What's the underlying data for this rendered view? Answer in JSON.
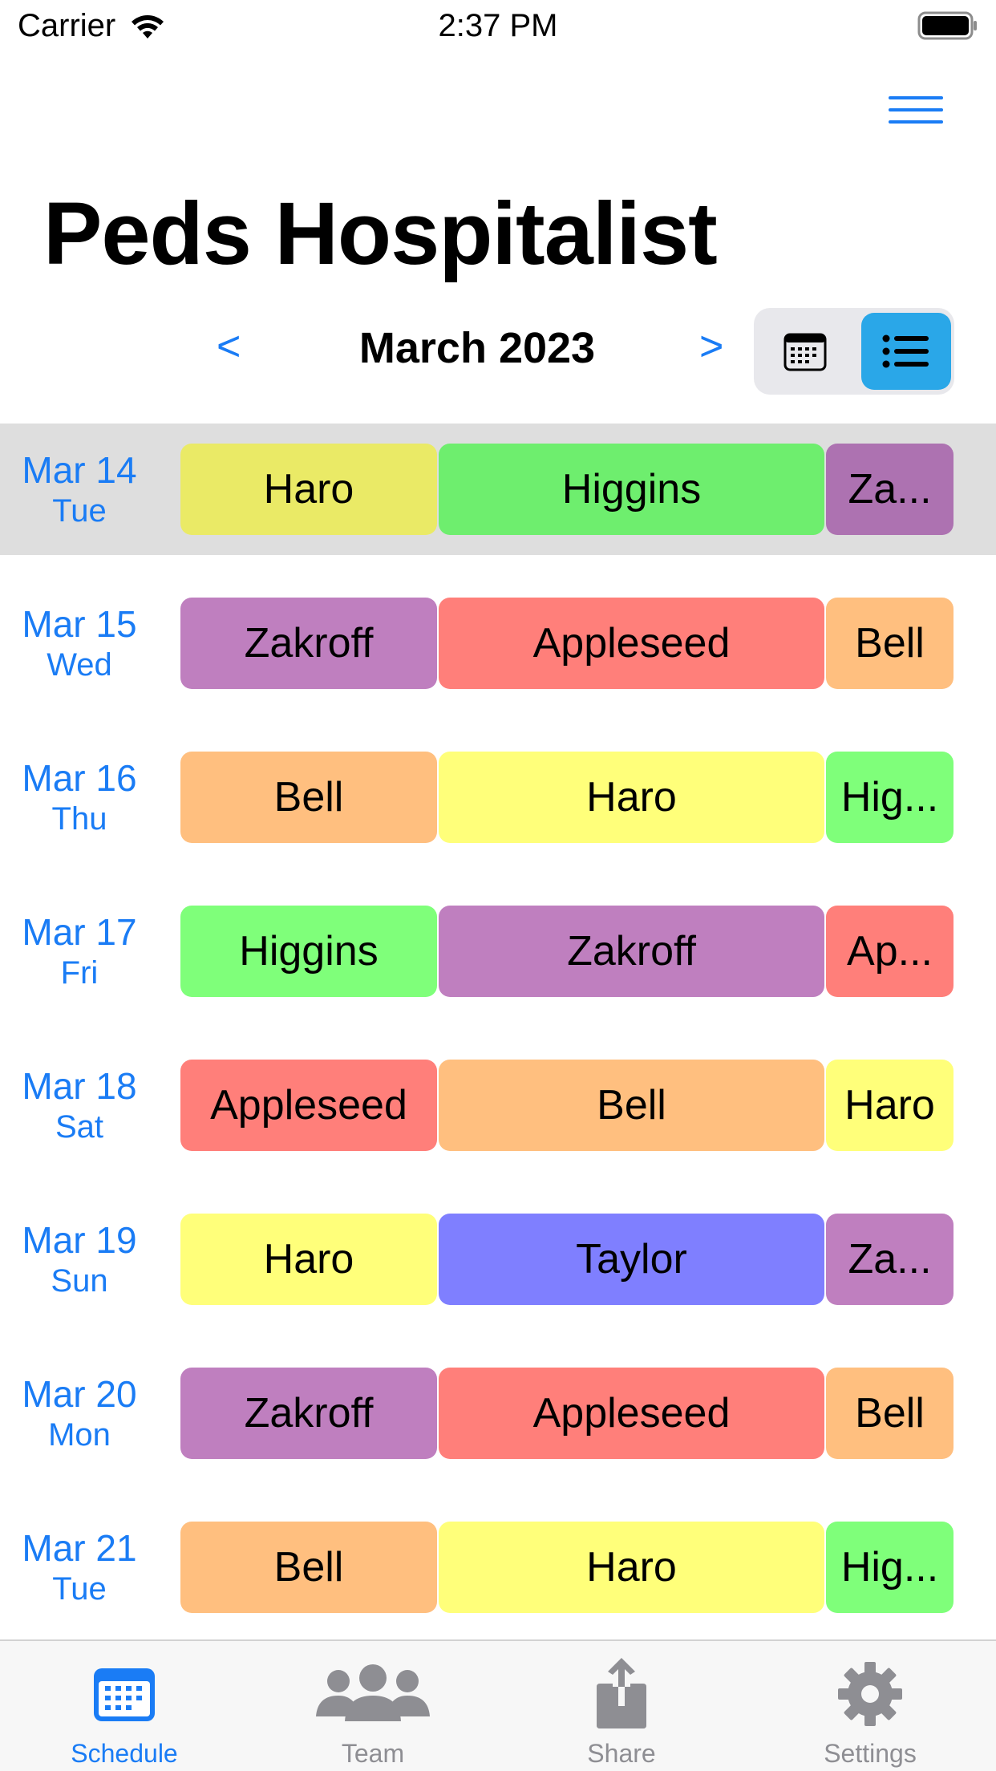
{
  "status_bar": {
    "carrier": "Carrier",
    "time": "2:37 PM"
  },
  "header": {
    "title": "Peds Hospitalist"
  },
  "month_nav": {
    "prev": "<",
    "month": "March 2023",
    "next": ">"
  },
  "colors": {
    "accent": "#1a7cf5",
    "toggle_active": "#2aa7e8",
    "Haro": "#ffff7a",
    "Haro_highlight": "#eaea66",
    "Higgins": "#7fff7a",
    "Higgins_highlight": "#6eee6e",
    "Zakroff": "#bf7fbf",
    "Zakroff_highlight": "#ad72b1",
    "Appleseed": "#ff7f7a",
    "Bell": "#ffbf7f",
    "Taylor": "#7f7fff"
  },
  "schedule": [
    {
      "date": "Mar 14",
      "weekday": "Tue",
      "highlighted": true,
      "shifts": [
        {
          "name": "Haro",
          "color": "#eaea66"
        },
        {
          "name": "Higgins",
          "color": "#6eee6e"
        },
        {
          "name": "Za...",
          "color": "#ad72b1"
        }
      ]
    },
    {
      "date": "Mar 15",
      "weekday": "Wed",
      "shifts": [
        {
          "name": "Zakroff",
          "color": "#bf7fbf"
        },
        {
          "name": "Appleseed",
          "color": "#ff7f7a"
        },
        {
          "name": "Bell",
          "color": "#ffbf7f"
        }
      ]
    },
    {
      "date": "Mar 16",
      "weekday": "Thu",
      "shifts": [
        {
          "name": "Bell",
          "color": "#ffbf7f"
        },
        {
          "name": "Haro",
          "color": "#ffff7a"
        },
        {
          "name": "Hig...",
          "color": "#7fff7a"
        }
      ]
    },
    {
      "date": "Mar 17",
      "weekday": "Fri",
      "shifts": [
        {
          "name": "Higgins",
          "color": "#7fff7a"
        },
        {
          "name": "Zakroff",
          "color": "#bf7fbf"
        },
        {
          "name": "Ap...",
          "color": "#ff7f7a"
        }
      ]
    },
    {
      "date": "Mar 18",
      "weekday": "Sat",
      "shifts": [
        {
          "name": "Appleseed",
          "color": "#ff7f7a"
        },
        {
          "name": "Bell",
          "color": "#ffbf7f"
        },
        {
          "name": "Haro",
          "color": "#ffff7a"
        }
      ]
    },
    {
      "date": "Mar 19",
      "weekday": "Sun",
      "shifts": [
        {
          "name": "Haro",
          "color": "#ffff7a"
        },
        {
          "name": "Taylor",
          "color": "#7f7fff"
        },
        {
          "name": "Za...",
          "color": "#bf7fbf"
        }
      ]
    },
    {
      "date": "Mar 20",
      "weekday": "Mon",
      "shifts": [
        {
          "name": "Zakroff",
          "color": "#bf7fbf"
        },
        {
          "name": "Appleseed",
          "color": "#ff7f7a"
        },
        {
          "name": "Bell",
          "color": "#ffbf7f"
        }
      ]
    },
    {
      "date": "Mar 21",
      "weekday": "Tue",
      "shifts": [
        {
          "name": "Bell",
          "color": "#ffbf7f"
        },
        {
          "name": "Haro",
          "color": "#ffff7a"
        },
        {
          "name": "Hig...",
          "color": "#7fff7a"
        }
      ]
    }
  ],
  "tabs": [
    {
      "label": "Schedule",
      "icon": "calendar-icon",
      "active": true
    },
    {
      "label": "Team",
      "icon": "team-icon",
      "active": false
    },
    {
      "label": "Share",
      "icon": "share-icon",
      "active": false
    },
    {
      "label": "Settings",
      "icon": "gear-icon",
      "active": false
    }
  ]
}
